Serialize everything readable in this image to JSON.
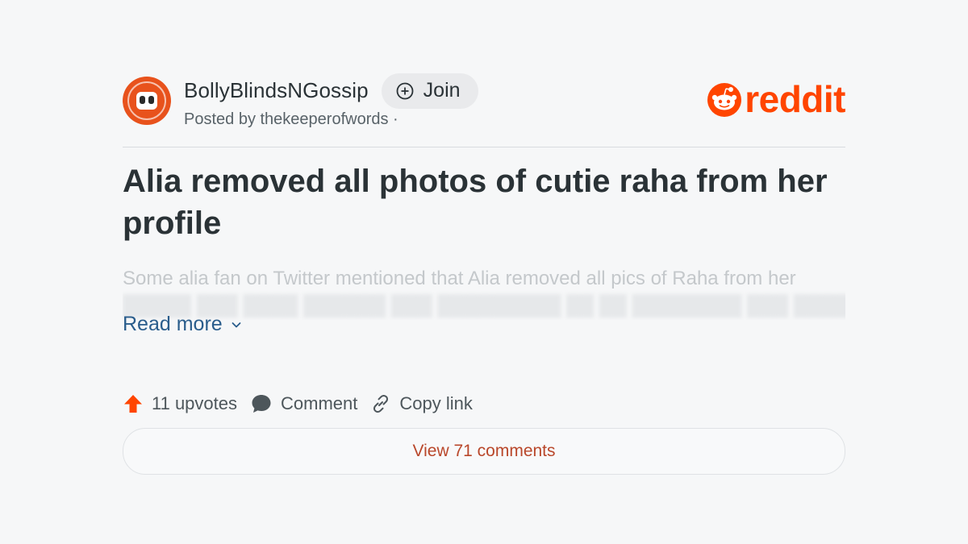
{
  "post": {
    "subreddit": "BollyBlindsNGossip",
    "join_label": "Join",
    "posted_by": "Posted by thekeeperofwords ·",
    "title": "Alia removed all photos of cutie raha from her profile",
    "body_line1": "Some alia fan on Twitter mentioned that Alia removed all pics of Raha from her",
    "read_more_label": "Read more"
  },
  "brand": {
    "name": "reddit",
    "color": "#ff4500"
  },
  "actions": {
    "upvotes_label": "11 upvotes",
    "comment_label": "Comment",
    "copy_link_label": "Copy link"
  },
  "view_comments_label": "View 71 comments",
  "icons": {
    "join": "plus-circle-icon",
    "upvote": "upvote-arrow-icon",
    "comment": "speech-bubble-icon",
    "copy_link": "link-icon",
    "read_more": "chevron-down-icon",
    "brand": "reddit-alien-icon"
  },
  "colors": {
    "accent": "#ff4500",
    "link": "#2a5d8c",
    "view_comments": "#b9472a"
  }
}
